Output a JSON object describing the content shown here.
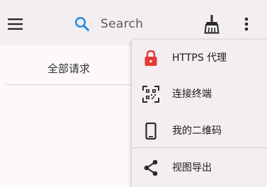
{
  "appbar": {
    "search_placeholder": "Search",
    "icons": {
      "menu": "hamburger-menu-icon",
      "search": "search-icon",
      "clear": "broom-icon",
      "more": "more-vertical-icon"
    }
  },
  "tabs": [
    {
      "label": "全部请求"
    }
  ],
  "menu": {
    "items": [
      {
        "label": "HTTPS 代理",
        "icon": "lock-icon",
        "icon_color": "#e53935"
      },
      {
        "label": "连接终端",
        "icon": "qr-scan-icon"
      },
      {
        "label": "我的二维码",
        "icon": "phone-icon"
      },
      {
        "label": "视图导出",
        "icon": "share-icon"
      }
    ]
  },
  "colors": {
    "accent": "#1e88e5",
    "lock": "#e53935",
    "appbar_bg": "#f2eef1",
    "menu_bg": "#f2eef2"
  }
}
